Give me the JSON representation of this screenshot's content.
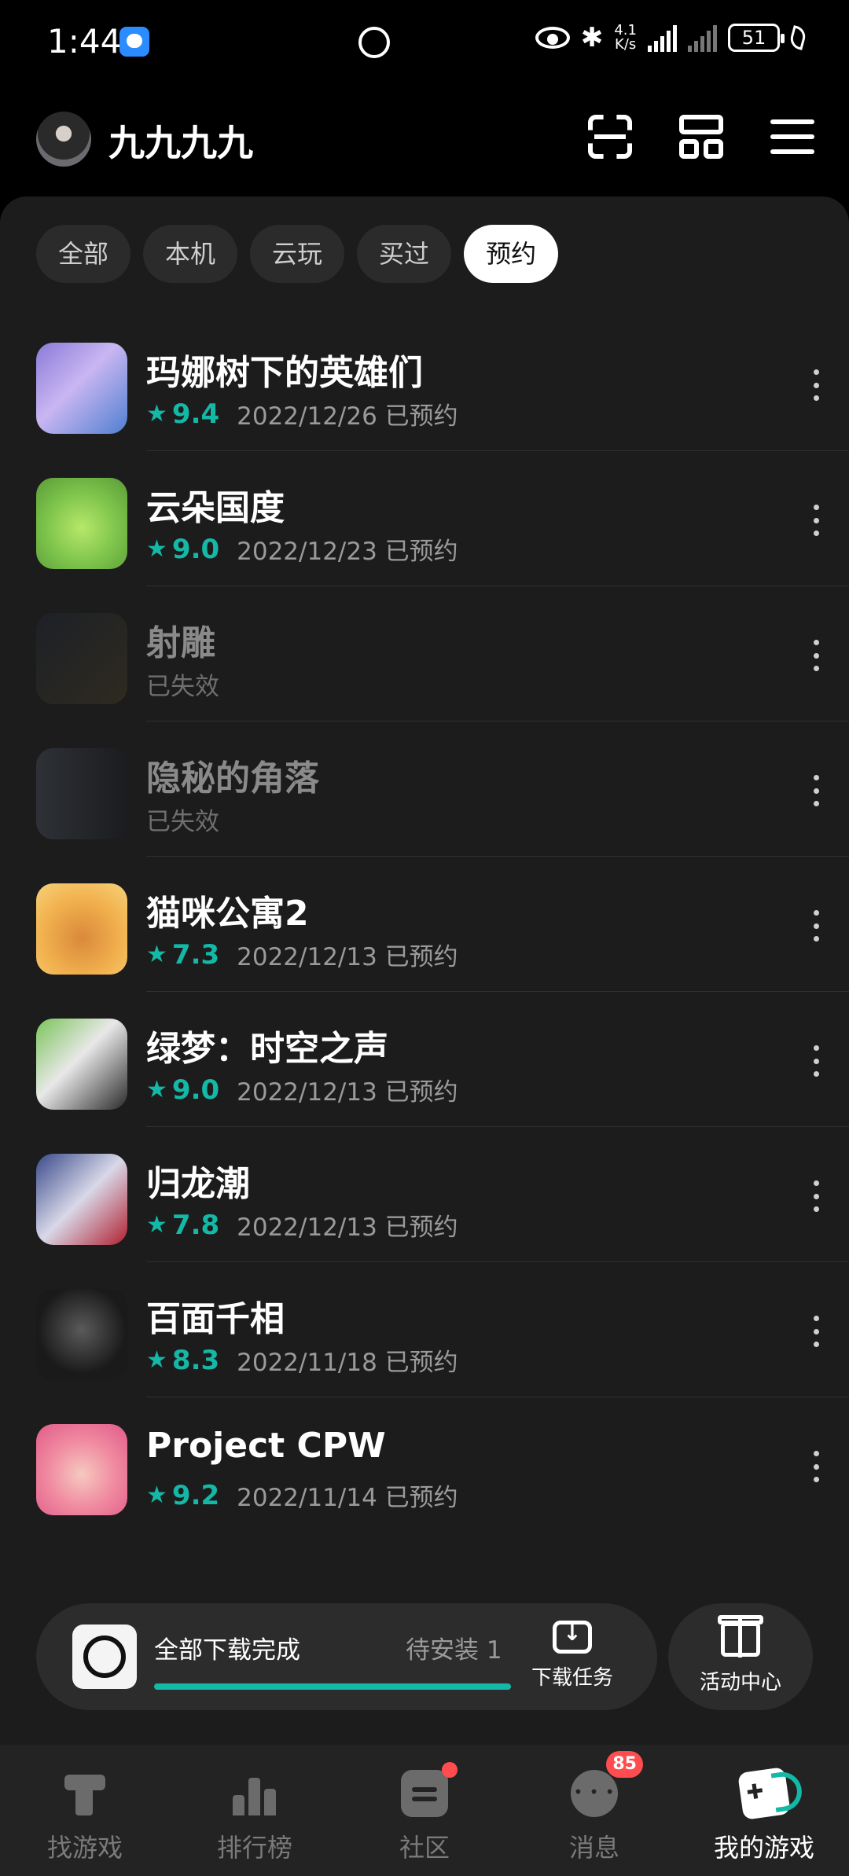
{
  "status_bar": {
    "time": "1:44",
    "net_speed_top": "4.1",
    "net_speed_bottom": "K/s",
    "battery": "51"
  },
  "header": {
    "username": "九九九九"
  },
  "tabs": [
    {
      "label": "全部"
    },
    {
      "label": "本机"
    },
    {
      "label": "云玩"
    },
    {
      "label": "买过"
    },
    {
      "label": "预约",
      "active": true
    }
  ],
  "games": [
    {
      "name": "玛娜树下的英雄们",
      "score": "9.4",
      "status": "2022/12/26 已预约",
      "expired": false
    },
    {
      "name": "云朵国度",
      "score": "9.0",
      "status": "2022/12/23 已预约",
      "expired": false
    },
    {
      "name": "射雕",
      "score": "",
      "status": "已失效",
      "expired": true
    },
    {
      "name": "隐秘的角落",
      "score": "",
      "status": "已失效",
      "expired": true
    },
    {
      "name": "猫咪公寓2",
      "score": "7.3",
      "status": "2022/12/13 已预约",
      "expired": false
    },
    {
      "name": "绿梦：时空之声",
      "score": "9.0",
      "status": "2022/12/13 已预约",
      "expired": false
    },
    {
      "name": "归龙潮",
      "score": "7.8",
      "status": "2022/12/13 已预约",
      "expired": false
    },
    {
      "name": "百面千相",
      "score": "8.3",
      "status": "2022/11/18 已预约",
      "expired": false
    },
    {
      "name": "Project CPW",
      "score": "9.2",
      "status": "2022/11/14 已预约",
      "expired": false
    }
  ],
  "download_bar": {
    "title": "全部下载完成",
    "pending": "待安装 1",
    "progress": 1.0,
    "task_label": "下载任务",
    "activity_label": "活动中心"
  },
  "nav": [
    {
      "label": "找游戏"
    },
    {
      "label": "排行榜"
    },
    {
      "label": "社区"
    },
    {
      "label": "消息",
      "badge": "85"
    },
    {
      "label": "我的游戏",
      "active": true
    }
  ],
  "colors": {
    "accent": "#14b8a6",
    "badge": "#ff4d4f"
  }
}
